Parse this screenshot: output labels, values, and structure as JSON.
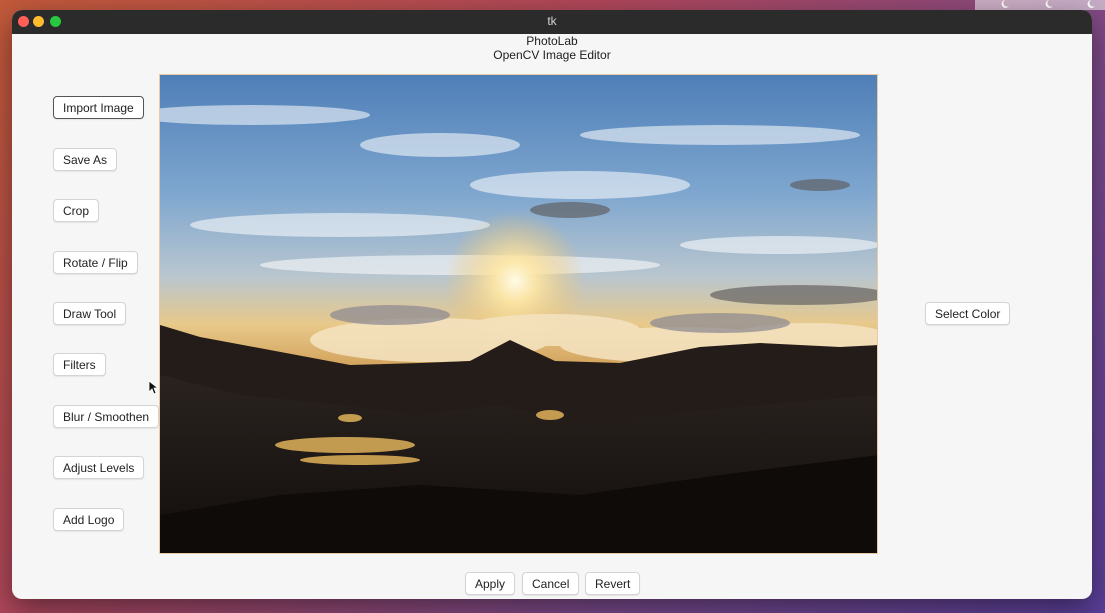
{
  "window": {
    "title": "tk"
  },
  "app": {
    "name": "PhotoLab",
    "subtitle": "OpenCV Image Editor"
  },
  "sidebar": {
    "buttons": [
      {
        "label": "Import Image"
      },
      {
        "label": "Save As"
      },
      {
        "label": "Crop"
      },
      {
        "label": "Rotate / Flip"
      },
      {
        "label": "Draw Tool"
      },
      {
        "label": "Filters"
      },
      {
        "label": "Blur / Smoothen"
      },
      {
        "label": "Adjust Levels"
      },
      {
        "label": "Add Logo"
      }
    ]
  },
  "right_panel": {
    "select_color_label": "Select Color"
  },
  "bottom": {
    "apply_label": "Apply",
    "cancel_label": "Cancel",
    "revert_label": "Revert"
  },
  "colors": {
    "window_bg": "#f6f6f6",
    "titlebar": "#2b2b2b",
    "canvas_border": "#e8c9a0"
  }
}
